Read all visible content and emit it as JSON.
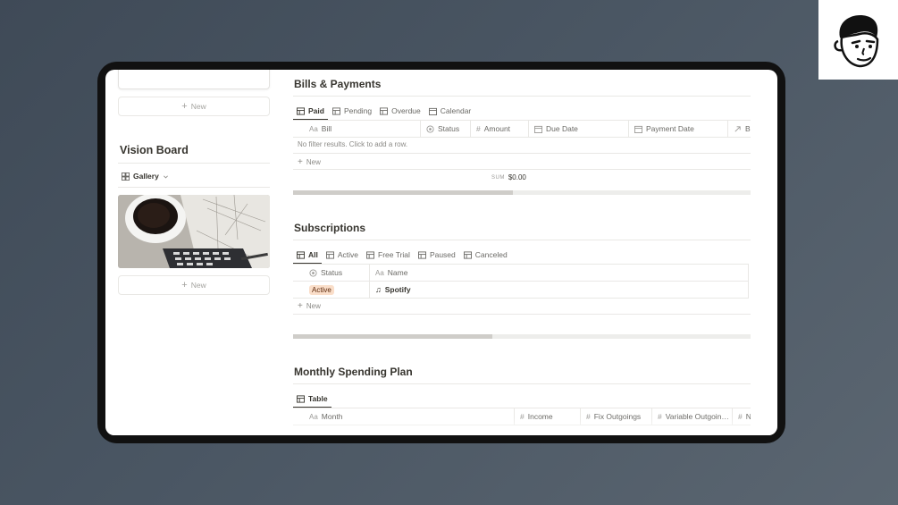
{
  "colors": {
    "accent_dark": "#37352f",
    "badge_bg": "#fadec9",
    "badge_text": "#5e2b0e"
  },
  "left": {
    "new_label_top": "New",
    "vision_board_title": "Vision Board",
    "gallery_label": "Gallery",
    "new_label_bottom": "New"
  },
  "bills": {
    "title": "Bills & Payments",
    "tabs": [
      "Paid",
      "Pending",
      "Overdue",
      "Calendar"
    ],
    "columns": [
      "Bill",
      "Status",
      "Amount",
      "Due Date",
      "Payment Date",
      "Bo"
    ],
    "empty_text": "No filter results. Click to add a row.",
    "new_label": "New",
    "sum_label": "SUM",
    "sum_value": "$0.00",
    "scroll_fraction": 0.48
  },
  "subscriptions": {
    "title": "Subscriptions",
    "tabs": [
      "All",
      "Active",
      "Free Trial",
      "Paused",
      "Canceled"
    ],
    "columns": [
      "Status",
      "Name"
    ],
    "rows": [
      {
        "status": "Active",
        "name": "Spotify"
      }
    ],
    "new_label": "New",
    "scroll_fraction": 0.435
  },
  "spending": {
    "title": "Monthly Spending Plan",
    "tabs": [
      "Table"
    ],
    "columns": [
      "Month",
      "Income",
      "Fix Outgoings",
      "Variable Outgoin…",
      "N"
    ]
  }
}
